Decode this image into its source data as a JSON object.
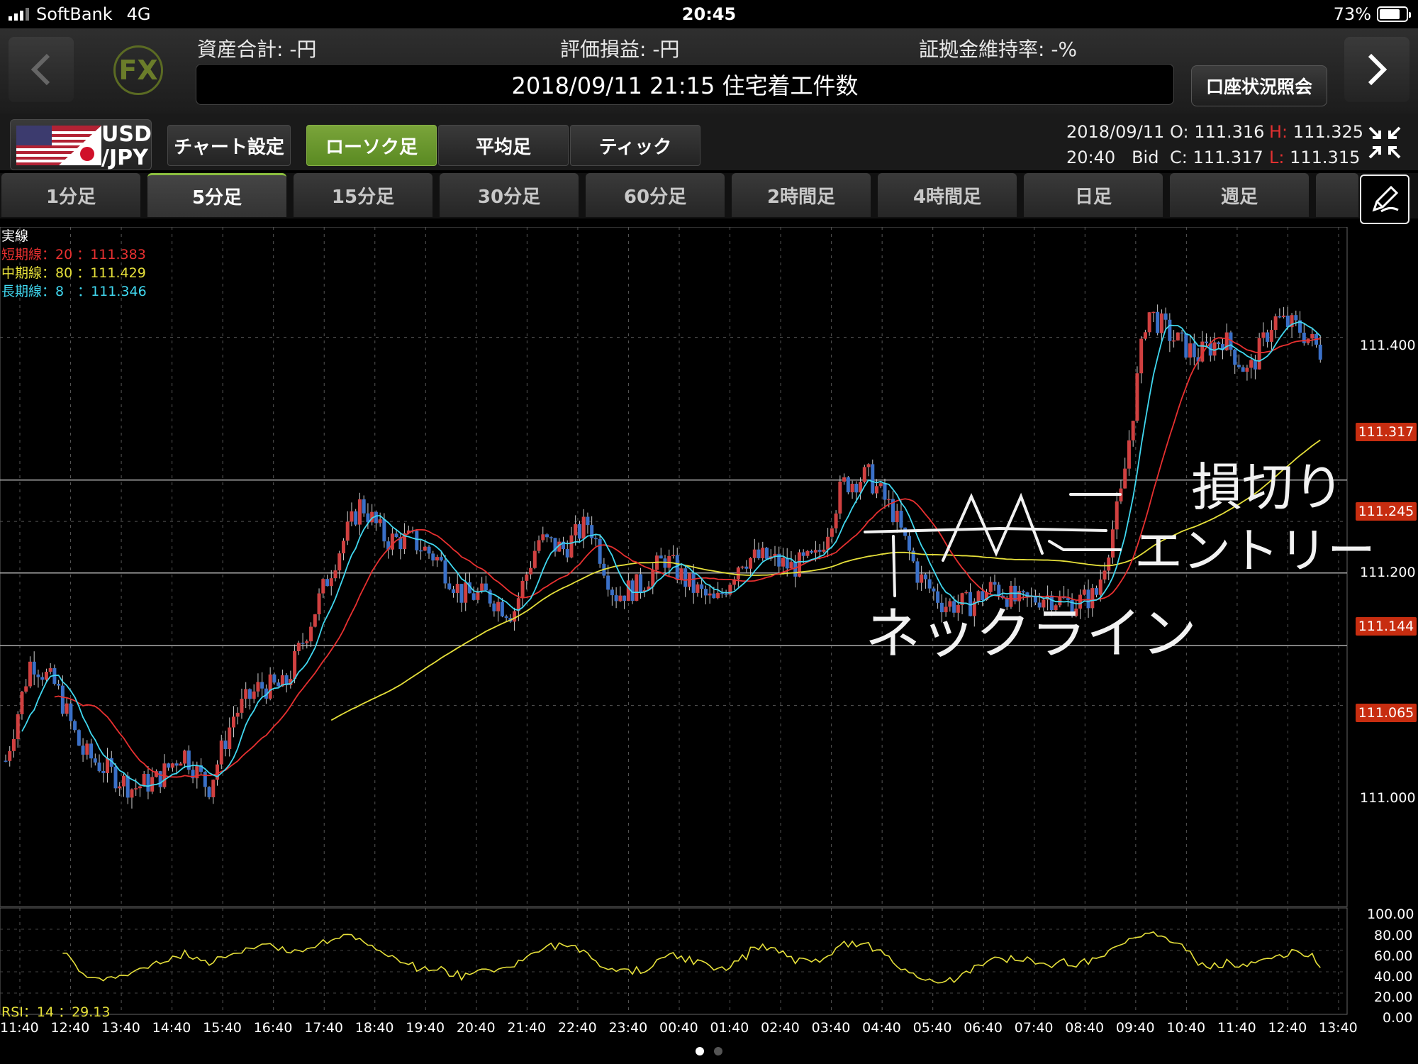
{
  "status_bar": {
    "carrier": "SoftBank",
    "network": "4G",
    "time": "20:45",
    "battery": "73%"
  },
  "header": {
    "asset_total": "資産合計: -円",
    "pnl": "評価損益: -円",
    "margin_rate": "証拠金維持率: -%",
    "news": "2018/09/11 21:15 住宅着工件数",
    "account_button": "口座状況照会",
    "logo": "FX"
  },
  "toolbar": {
    "pair_top": "USD",
    "pair_bottom": "/JPY",
    "chart_settings": "チャート設定",
    "chart_types": [
      "ローソク足",
      "平均足",
      "ティック"
    ],
    "active_chart_type": 0,
    "date": "2018/09/11",
    "time": "20:40",
    "side": "Bid",
    "o_label": "O:",
    "o_value": "111.316",
    "h_label": "H:",
    "h_value": "111.325",
    "c_label": "C:",
    "c_value": "111.317",
    "l_label": "L:",
    "l_value": "111.315"
  },
  "timeframes": [
    "1分足",
    "5分足",
    "15分足",
    "30分足",
    "60分足",
    "2時間足",
    "4時間足",
    "日足",
    "週足"
  ],
  "active_timeframe": 1,
  "legend": {
    "title": "実線",
    "short": "短期線：20 ：111.383",
    "mid": "中期線：80 ：111.429",
    "long": "長期線：8　：111.346"
  },
  "colors": {
    "short_ma": "#e83030",
    "mid_ma": "#e6e03a",
    "long_ma": "#40d8f0",
    "bull": "#d04040",
    "bear": "#3a70c8",
    "rsi": "#e6e03a",
    "active": "#6e9e32"
  },
  "chart_data": {
    "type": "candlestick",
    "symbol": "USD/JPY",
    "interval": "5分足",
    "y_ticks": [
      "111.400",
      "111.200",
      "111.000"
    ],
    "price_tags": [
      "111.317",
      "111.245",
      "111.144",
      "111.065"
    ],
    "x_ticks": [
      "11:40",
      "12:40",
      "13:40",
      "14:40",
      "15:40",
      "16:40",
      "17:40",
      "18:40",
      "19:40",
      "20:40",
      "21:40",
      "22:40",
      "23:40",
      "00:40",
      "01:40",
      "02:40",
      "03:40",
      "04:40",
      "05:40",
      "06:40",
      "07:40",
      "08:40",
      "09:40",
      "10:40",
      "11:40",
      "12:40",
      "13:40"
    ],
    "close_path": [
      [
        0,
        110.94
      ],
      [
        0.5,
        111.05
      ],
      [
        1,
        111.02
      ],
      [
        1.5,
        110.95
      ],
      [
        2,
        110.93
      ],
      [
        2.5,
        110.91
      ],
      [
        3,
        110.92
      ],
      [
        3.5,
        110.95
      ],
      [
        4,
        110.91
      ],
      [
        4.5,
        110.99
      ],
      [
        5,
        111.02
      ],
      [
        5.5,
        111.02
      ],
      [
        6,
        111.09
      ],
      [
        6.5,
        111.16
      ],
      [
        7,
        111.22
      ],
      [
        7.5,
        111.18
      ],
      [
        8,
        111.18
      ],
      [
        8.5,
        111.16
      ],
      [
        9,
        111.12
      ],
      [
        9.5,
        111.12
      ],
      [
        10,
        111.1
      ],
      [
        10.5,
        111.18
      ],
      [
        11,
        111.17
      ],
      [
        11.5,
        111.2
      ],
      [
        12,
        111.12
      ],
      [
        12.5,
        111.13
      ],
      [
        13,
        111.16
      ],
      [
        13.5,
        111.13
      ],
      [
        14,
        111.11
      ],
      [
        14.5,
        111.16
      ],
      [
        15,
        111.16
      ],
      [
        15.5,
        111.15
      ],
      [
        16,
        111.16
      ],
      [
        16.5,
        111.24
      ],
      [
        17,
        111.25
      ],
      [
        17.5,
        111.21
      ],
      [
        18,
        111.14
      ],
      [
        18.5,
        111.11
      ],
      [
        19,
        111.11
      ],
      [
        19.5,
        111.13
      ],
      [
        20,
        111.11
      ],
      [
        20.5,
        111.12
      ],
      [
        21,
        111.11
      ],
      [
        21.5,
        111.12
      ],
      [
        22,
        111.23
      ],
      [
        22.5,
        111.43
      ],
      [
        23,
        111.4
      ],
      [
        23.5,
        111.38
      ],
      [
        24,
        111.4
      ],
      [
        24.5,
        111.36
      ],
      [
        25,
        111.42
      ],
      [
        25.5,
        111.41
      ],
      [
        26,
        111.38
      ],
      [
        26.5,
        111.39
      ],
      [
        27,
        111.4
      ]
    ],
    "short_ma": "20",
    "mid_ma": "80",
    "long_ma": "8",
    "rsi_ticks": [
      "100.00",
      "80.00",
      "60.00",
      "40.00",
      "20.00",
      "0.00"
    ],
    "rsi_label": "RSI：14 ：29.13"
  },
  "annotations": {
    "stop": "損切り",
    "entry": "エントリー",
    "neckline": "ネックライン"
  }
}
